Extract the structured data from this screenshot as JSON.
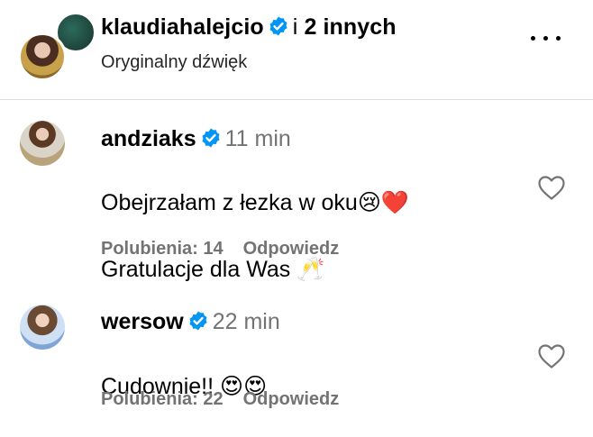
{
  "header": {
    "username": "klaudiahalejcio",
    "collab_prefix": "i",
    "collab_count": "2 innych",
    "audio_label": "Oryginalny dźwięk",
    "menu_icon": "more-horizontal-icon"
  },
  "comments": [
    {
      "username": "andziaks",
      "time": "11 min",
      "text_line1": "Obejrzałam z łezka w oku😢❤️",
      "text_line2": "Gratulacje dla Was 🥂",
      "likes_label": "Polubienia: 14",
      "reply_label": "Odpowiedz",
      "like_icon": "heart-outline-icon"
    },
    {
      "username": "wersow",
      "time": "22 min",
      "text_line1": "Cudownie!! 😍😍",
      "likes_label": "Polubienia: 22",
      "reply_label": "Odpowiedz",
      "like_icon": "heart-outline-icon"
    }
  ],
  "colors": {
    "verified_badge": "#0095f6",
    "secondary_text": "#737373"
  }
}
